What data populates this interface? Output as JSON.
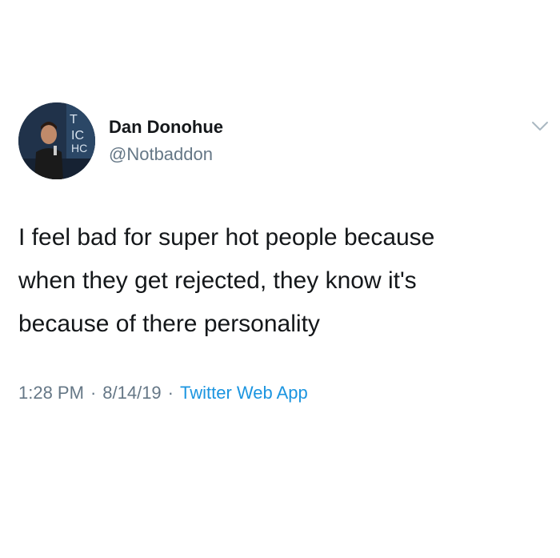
{
  "tweet": {
    "author_name": "Dan Donohue",
    "author_handle": "@Notbaddon",
    "text": "I feel bad for super hot people because\nwhen they get rejected, they know it's\nbecause of there personality",
    "time": "1:28 PM",
    "date": "8/14/19",
    "separator": "·",
    "source": "Twitter Web App",
    "menu_icon": "chevron-down-icon",
    "avatar_icon": "profile-photo"
  },
  "colors": {
    "text": "#14171a",
    "secondary": "#657786",
    "link": "#1b95e0",
    "background": "#ffffff"
  }
}
